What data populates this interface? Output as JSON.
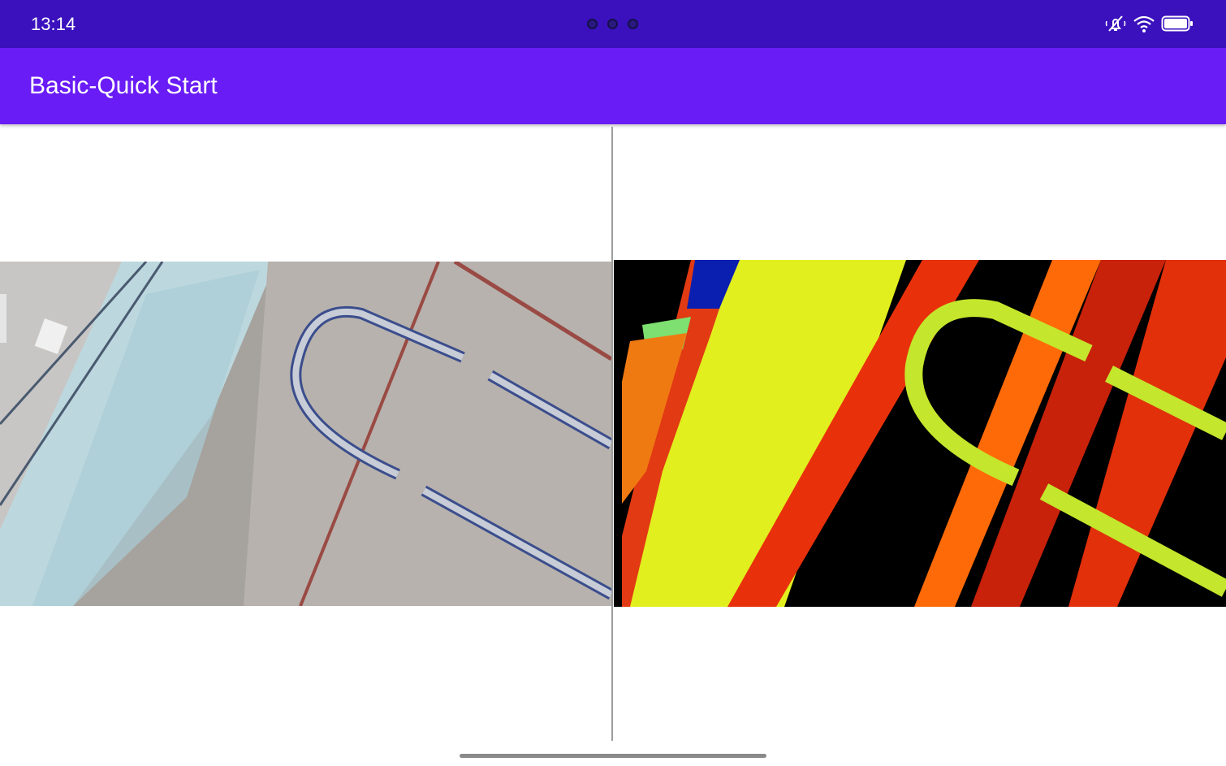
{
  "status_bar": {
    "time": "13:14",
    "icons": [
      "notifications-muted-icon",
      "wifi-icon",
      "battery-icon"
    ],
    "background": "#3a11bd"
  },
  "app_bar": {
    "title": "Basic-Quick Start",
    "background": "#6a1cf6"
  },
  "panels": {
    "left": "rgb-camera-view",
    "right": "depth-colormap-view"
  }
}
